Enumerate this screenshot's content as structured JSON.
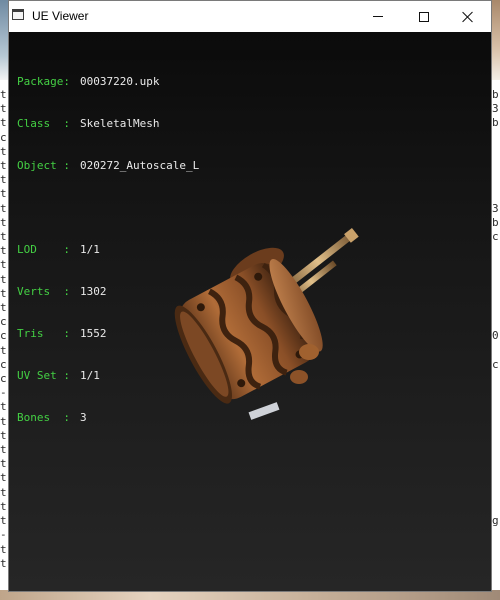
{
  "window": {
    "title": "UE Viewer",
    "app_icon": "window-icon",
    "controls": {
      "minimize": "minimize-icon",
      "maximize": "maximize-icon",
      "close": "close-icon"
    }
  },
  "info_primary": [
    {
      "label": "Package:",
      "value": "00037220.upk"
    },
    {
      "label": "Class  :",
      "value": "SkeletalMesh"
    },
    {
      "label": "Object :",
      "value": "020272_Autoscale_L"
    }
  ],
  "info_stats": [
    {
      "label": "LOD    :",
      "value": "1/1"
    },
    {
      "label": "Verts  :",
      "value": "1302"
    },
    {
      "label": "Tris   :",
      "value": "1552"
    },
    {
      "label": "UV Set :",
      "value": "1/1"
    },
    {
      "label": "Bones  :",
      "value": "3"
    }
  ],
  "colors": {
    "label_green": "#44d044",
    "value_text": "#eaeaea",
    "viewport_top": "#0b0b0b",
    "viewport_bottom": "#262626",
    "mesh_bronze": "#9a5a2e"
  },
  "background_glyphs": {
    "left": "t\nt\nt\nc\nt\nt\nt\nt\nt\nt\nt\nt\nt\nt\nt\nt\nc\nc\nt\nc\nc\n-\nt\nt\nt\nt\nt\nt\nt\nt\nt\n-\nt\nt",
    "right": "b\n3\nb\n\n\n\n\n\n3\nb\nc\n\n\n\n\n\n\n0\n\nc\n\n\n\n\n\n\n\n\n\n\ng\n"
  }
}
